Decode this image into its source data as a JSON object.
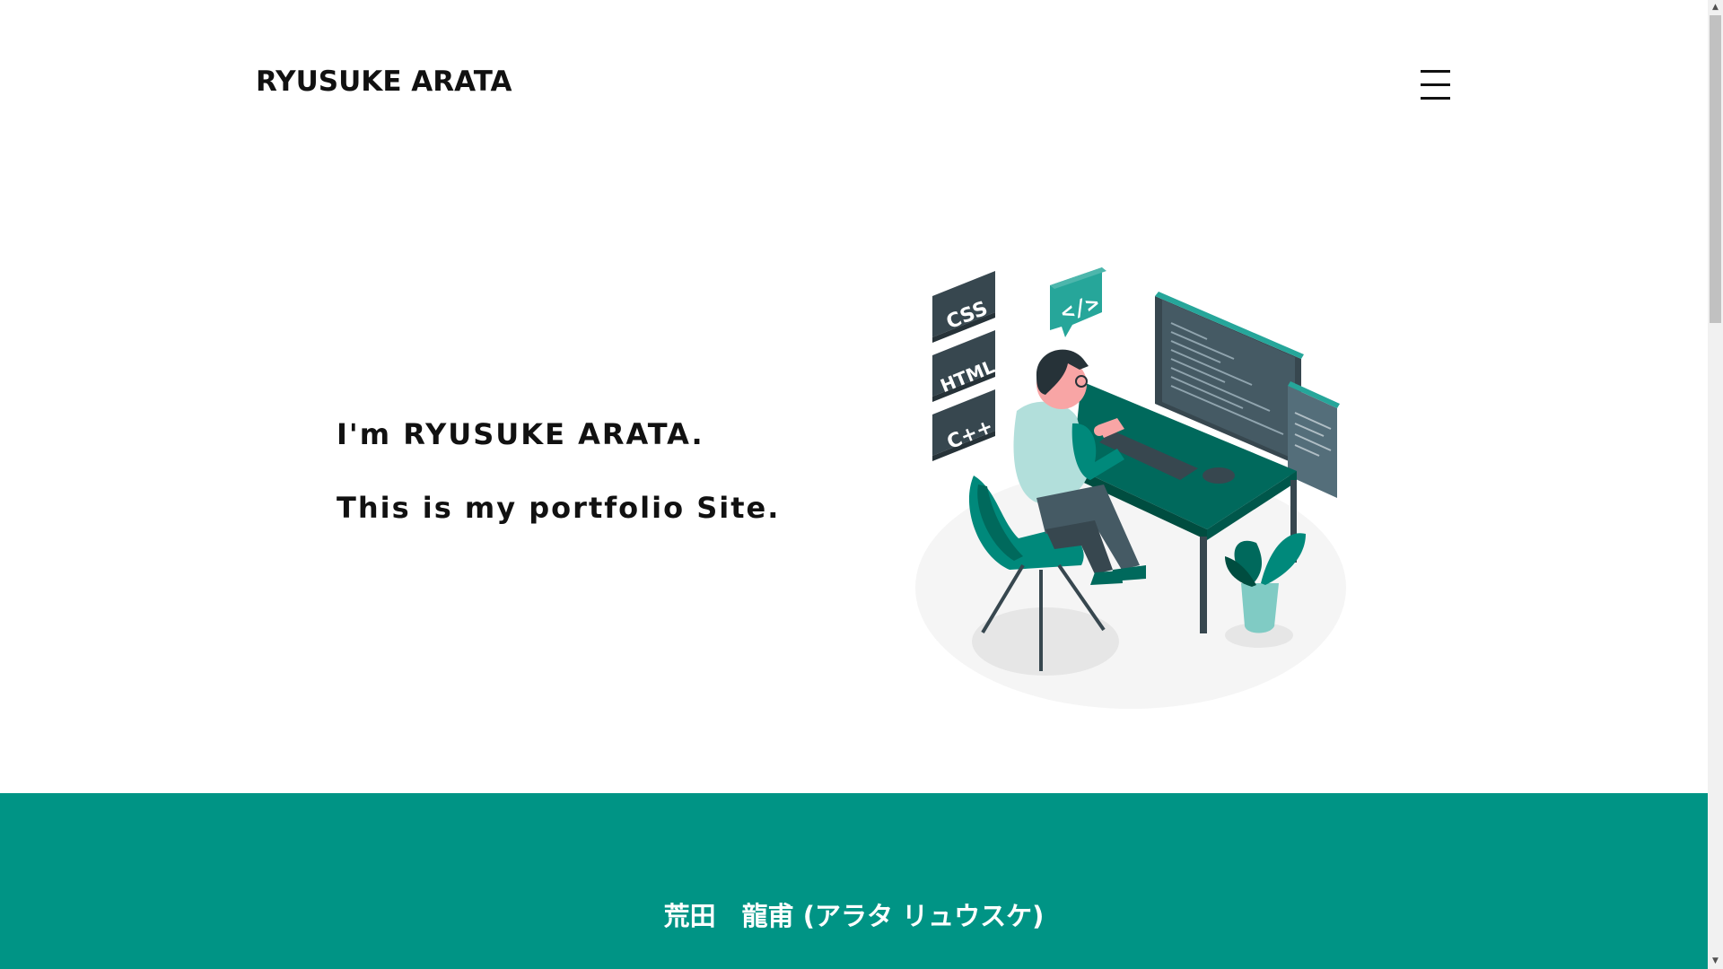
{
  "header": {
    "logo_text": "RYUSUKE ARATA",
    "menu_icon": "hamburger-menu-icon"
  },
  "hero": {
    "line1": "I'm RYUSUKE ARATA.",
    "line2": "This is my portfolio Site.",
    "illustration": {
      "description_icon": "developer-at-desk-illustration",
      "tags": [
        "CSS",
        "HTML",
        "C++"
      ],
      "code_badge": "</>"
    }
  },
  "profile": {
    "name": "荒田　龍甫 (アラタ リュウスケ)"
  },
  "colors": {
    "accent": "#009485",
    "text": "#111111",
    "background": "#ffffff"
  },
  "scrollbar": {
    "up_arrow": "▲",
    "down_arrow": "▼"
  }
}
